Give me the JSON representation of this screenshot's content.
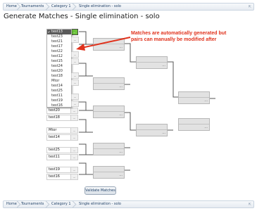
{
  "breadcrumb": {
    "items": [
      "Home",
      "Tournaments",
      "Category 1",
      "Single elimination - solo"
    ]
  },
  "page": {
    "title": "Generate Matches - Single elimination - solo"
  },
  "annotation": {
    "line1": "Matches are automatically generated but",
    "line2": "pairs can manually be modified after"
  },
  "dropdown": {
    "selected": "test13",
    "options": [
      "test23",
      "test21",
      "test17",
      "test22",
      "test12",
      "test15",
      "test24",
      "test20",
      "test18",
      "Mtor",
      "test14",
      "test25",
      "test11",
      "test19",
      "test16"
    ]
  },
  "round1": {
    "slots": [
      "test13",
      "",
      "",
      "",
      "",
      "",
      "",
      "",
      "",
      "",
      "",
      "",
      "",
      "",
      "test20",
      "test18",
      "",
      "Mtor",
      "test14",
      "",
      "test25",
      "test11",
      "",
      "test19",
      "test16"
    ]
  },
  "match_menu_label": "...",
  "validate_button": "Validate Matches",
  "colors": {
    "annotation": "#e0321c",
    "selected_green": "#6bc33b",
    "breadcrumb_text": "#1e3f66"
  }
}
